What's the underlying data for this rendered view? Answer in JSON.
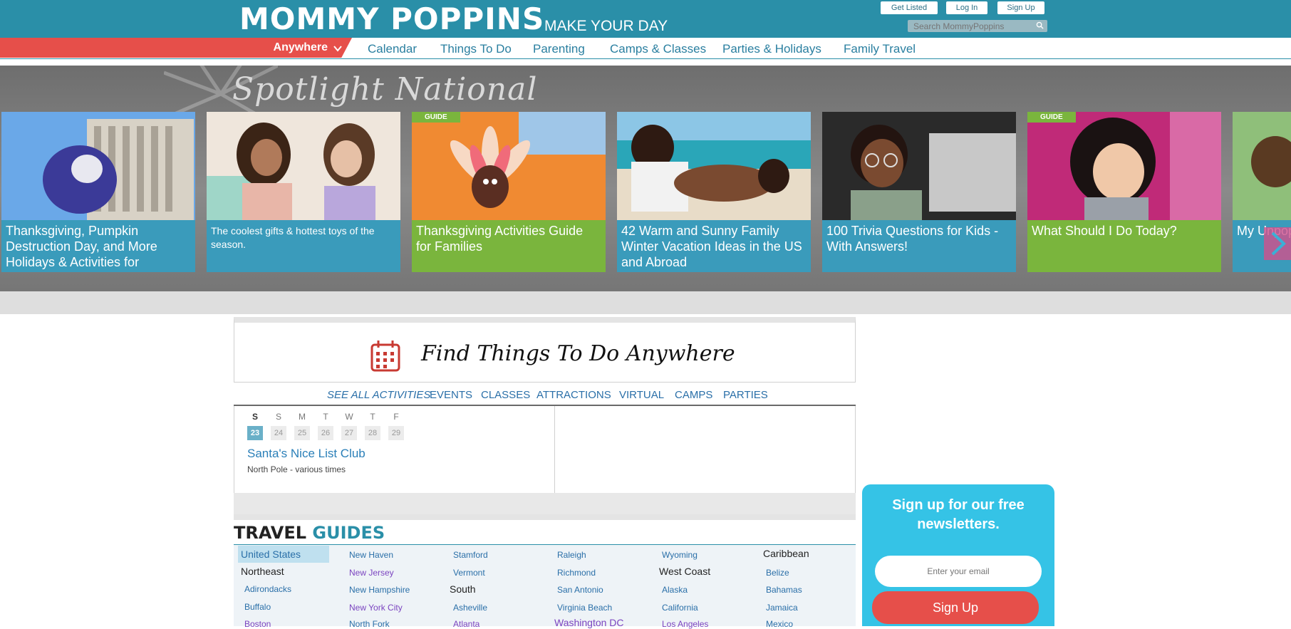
{
  "header": {
    "logo": "MOMMY POPPINS",
    "tagline": "MAKE YOUR DAY",
    "get_listed": "Get Listed",
    "log_in": "Log In",
    "sign_up": "Sign Up",
    "search_placeholder": "Search MommyPoppins"
  },
  "nav": {
    "location": "Anywhere",
    "links": [
      "Calendar",
      "Things To Do",
      "Parenting",
      "Camps & Classes",
      "Parties & Holidays",
      "Family Travel"
    ]
  },
  "spotlight": {
    "title": "Spotlight National",
    "cards": [
      {
        "caption": "Thanksgiving, Pumpkin Destruction Day, and More Holidays & Activities for",
        "badge": ""
      },
      {
        "caption": "The coolest gifts & hottest toys of the season.",
        "badge": ""
      },
      {
        "caption": "Thanksgiving Activities Guide for Families",
        "badge": "GUIDE"
      },
      {
        "caption": "42 Warm and Sunny Family Winter Vacation Ideas in the US and Abroad",
        "badge": ""
      },
      {
        "caption": "100 Trivia Questions for Kids - With Answers!",
        "badge": ""
      },
      {
        "caption": "What Should I Do Today?",
        "badge": "GUIDE"
      },
      {
        "caption": "My Unpop Shouldn't",
        "badge": ""
      }
    ]
  },
  "find": {
    "title": "Find Things To Do Anywhere",
    "tabs": [
      "SEE ALL ACTIVITIES",
      "EVENTS",
      "CLASSES",
      "ATTRACTIONS",
      "VIRTUAL",
      "CAMPS",
      "PARTIES"
    ]
  },
  "calendar": {
    "days": [
      "S",
      "S",
      "M",
      "T",
      "W",
      "T",
      "F"
    ],
    "dates": [
      "23",
      "24",
      "25",
      "26",
      "27",
      "28",
      "29"
    ],
    "selected_date": "23",
    "event_title": "Santa's Nice List Club",
    "event_sub": "North Pole - various times"
  },
  "travel": {
    "title_1": "TRAVEL",
    "title_2": "GUIDES",
    "col1": [
      "United States",
      "Northeast",
      "Adirondacks",
      "Buffalo",
      "Boston"
    ],
    "col2": [
      "New Haven",
      "New Jersey",
      "New Hampshire",
      "New York City",
      "North Fork"
    ],
    "col3": [
      "Stamford",
      "Vermont",
      "South",
      "Asheville",
      "Atlanta"
    ],
    "col4": [
      "Raleigh",
      "Richmond",
      "San Antonio",
      "Virginia Beach",
      "Washington DC"
    ],
    "col5": [
      "Wyoming",
      "West Coast",
      "Alaska",
      "California",
      "Los Angeles"
    ],
    "col6": [
      "Caribbean",
      "Belize",
      "Bahamas",
      "Jamaica",
      "Mexico"
    ]
  },
  "newsletter": {
    "title": "Sign up for our free newsletters.",
    "email_placeholder": "Enter your email",
    "button": "Sign Up"
  },
  "colors": {
    "brand_teal": "#2a8fa8",
    "accent_red": "#e64f4a",
    "guide_green": "#7ab53d",
    "caption_blue": "#3a9bbb",
    "newsletter_blue": "#35c3e6"
  }
}
